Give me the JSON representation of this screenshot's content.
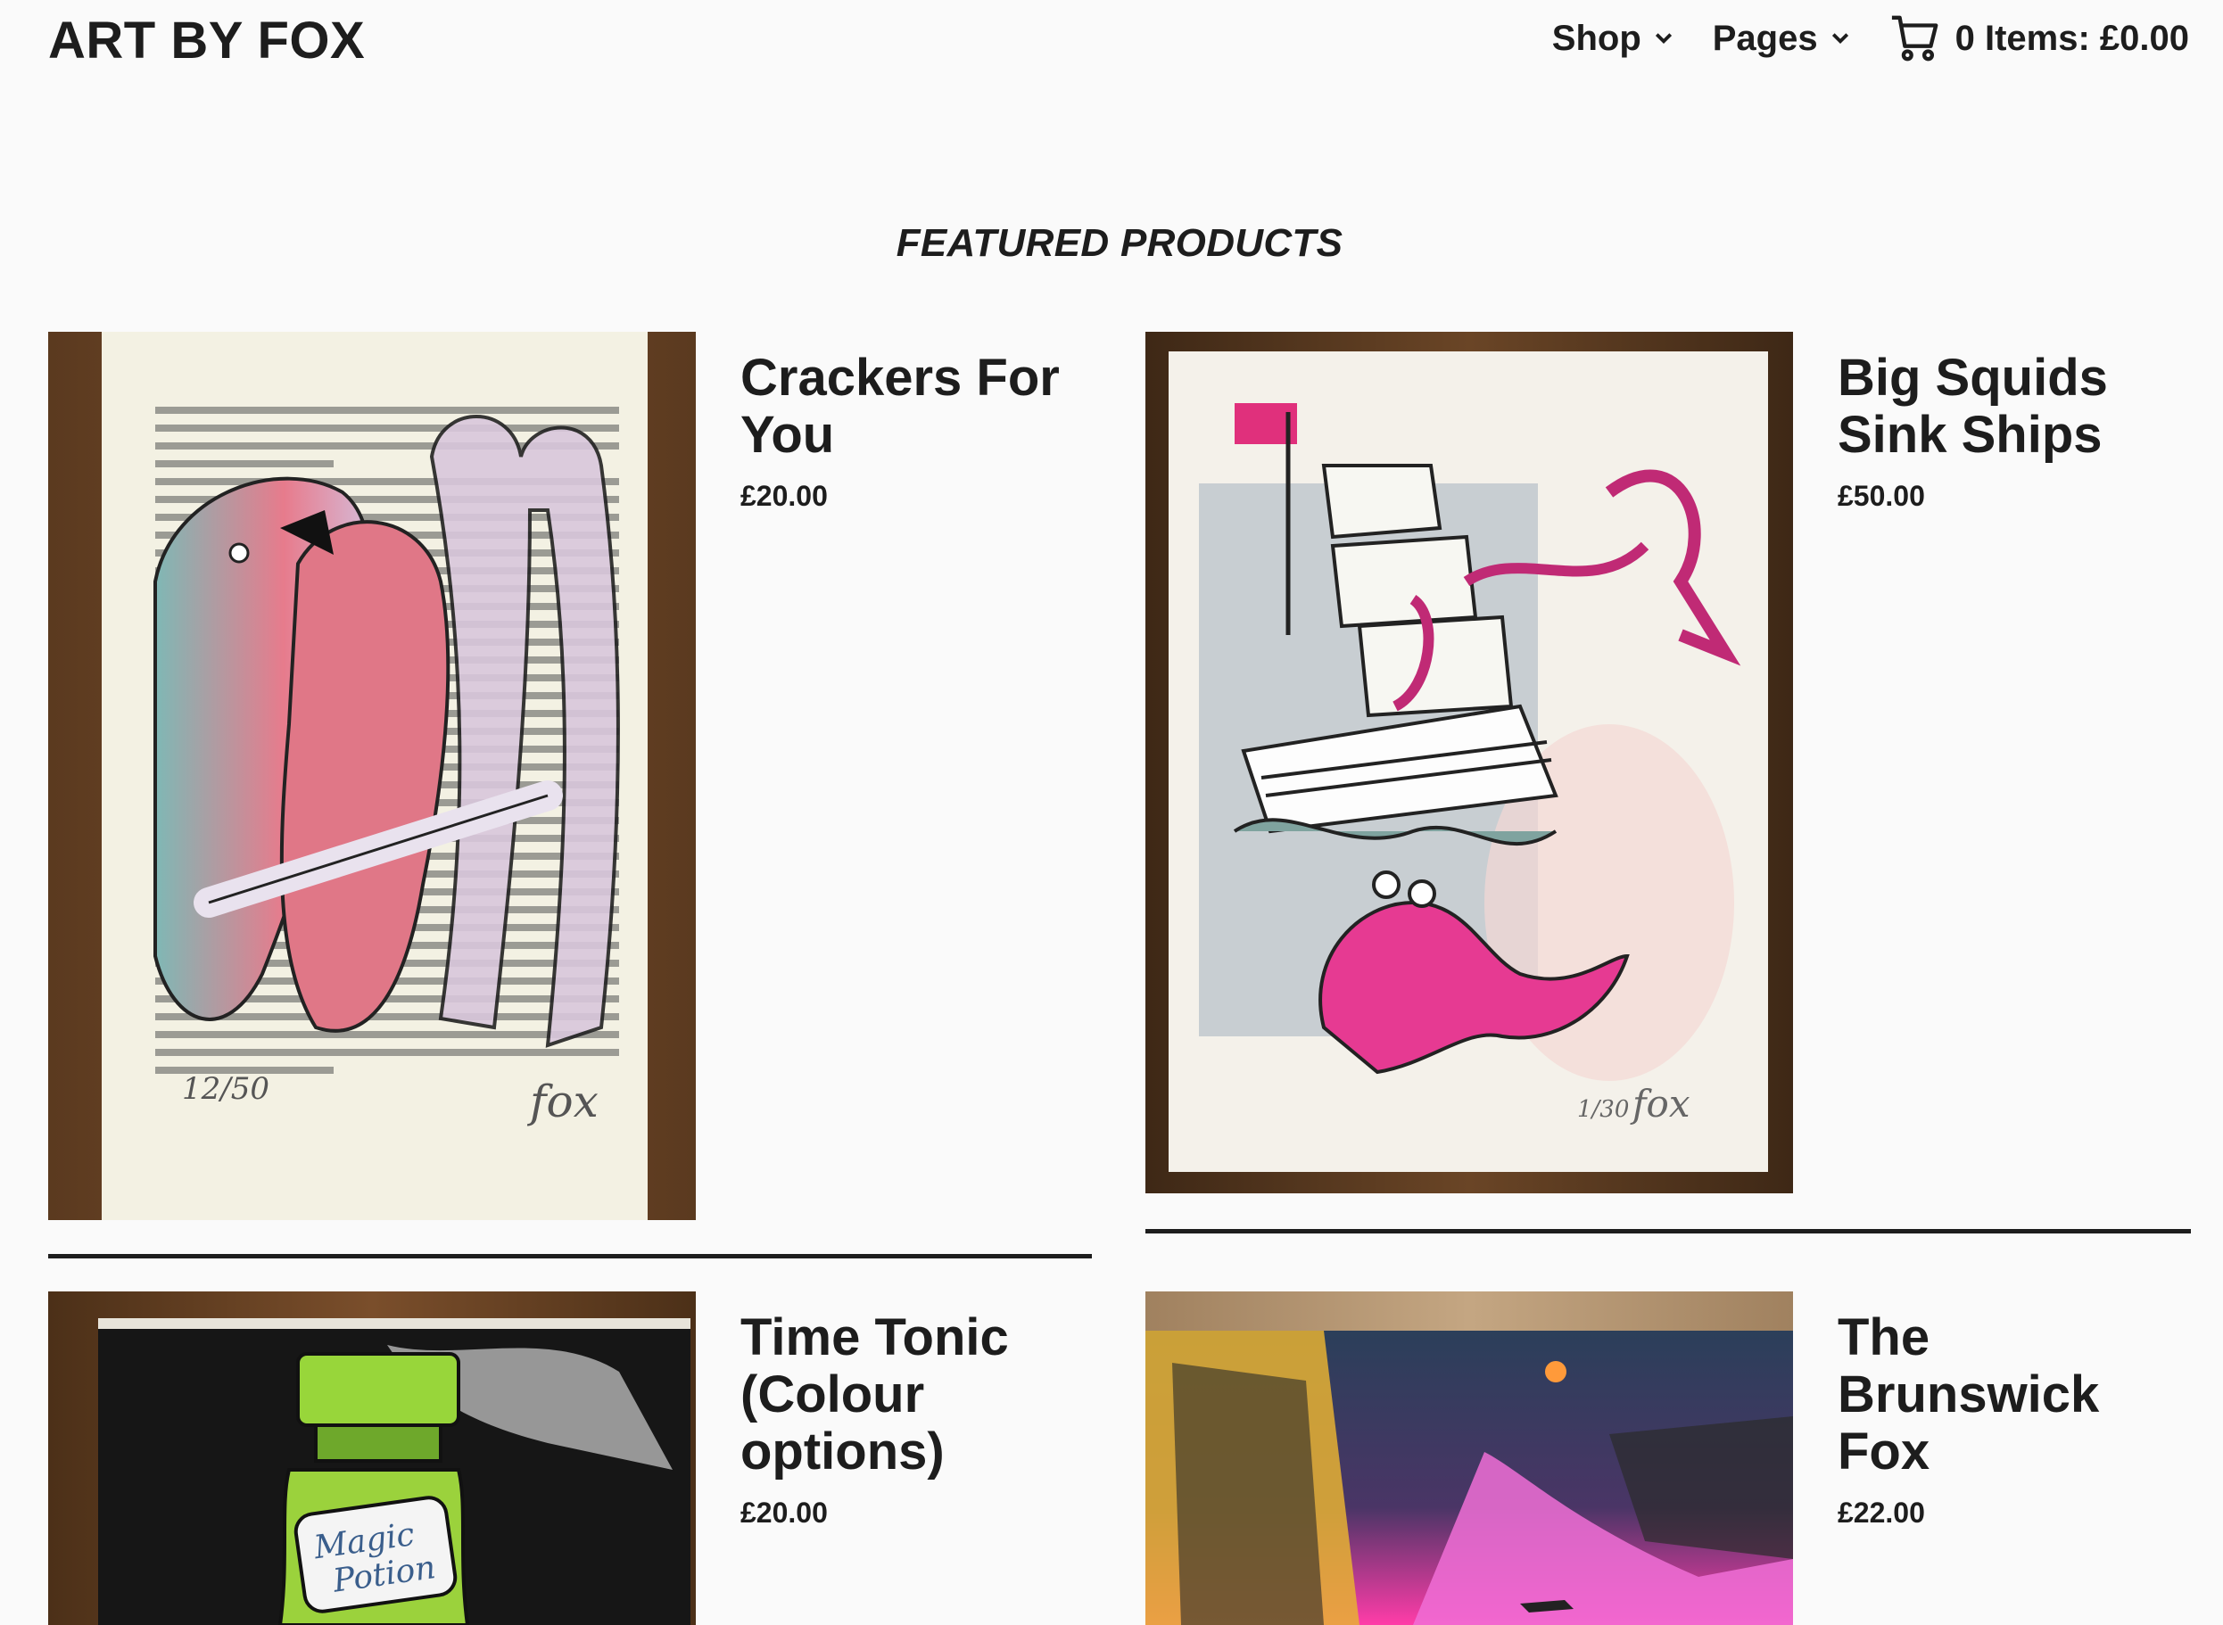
{
  "header": {
    "logo": "ART BY FOX",
    "nav": [
      {
        "label": "Shop"
      },
      {
        "label": "Pages"
      }
    ],
    "cart_label": "0 Items: £0.00"
  },
  "main": {
    "section_title": "FEATURED PRODUCTS",
    "products": [
      {
        "title": "Crackers For You",
        "price": "£20.00",
        "image": "two-parrots-print-on-book-page"
      },
      {
        "title": "Big Squids Sink Ships",
        "price": "£50.00",
        "image": "squid-and-ship-print"
      },
      {
        "title": "Time Tonic (Colour options)",
        "price": "£20.00",
        "image": "magic-potion-bottle-print"
      },
      {
        "title": "The Brunswick Fox",
        "price": "£22.00",
        "image": "fox-in-street-at-night-print"
      }
    ]
  },
  "artwork_text": {
    "parrot_edition": "12/50",
    "parrot_signature": "fox",
    "squid_edition": "1/30",
    "squid_signature": "fox",
    "potion_label_line1": "Magic",
    "potion_label_line2": "Potion"
  },
  "colors": {
    "page_bg": "#fafafa",
    "text": "#1d1d1d",
    "wood": "#5a3a22",
    "accent_pink": "#e0307c"
  }
}
